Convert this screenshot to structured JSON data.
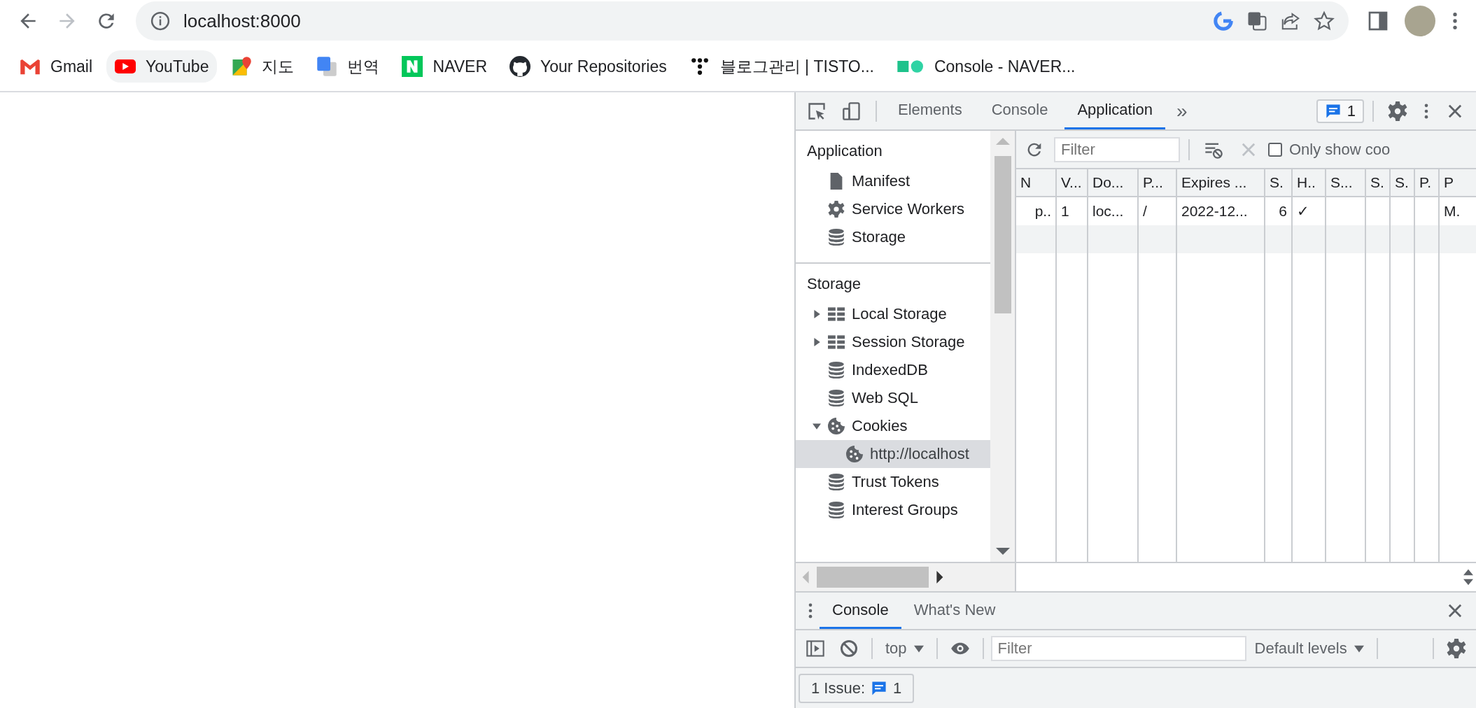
{
  "browser": {
    "url": "localhost:8000",
    "forward_disabled": true
  },
  "bookmarks": [
    {
      "kind": "gmail",
      "label": "Gmail",
      "hovered": false
    },
    {
      "kind": "youtube",
      "label": "YouTube",
      "hovered": true
    },
    {
      "kind": "maps",
      "label": "지도",
      "hovered": false
    },
    {
      "kind": "translate",
      "label": "번역",
      "hovered": false
    },
    {
      "kind": "naver",
      "label": "NAVER",
      "hovered": false
    },
    {
      "kind": "github",
      "label": "Your Repositories",
      "hovered": false
    },
    {
      "kind": "dots",
      "label": "블로그관리 | TISTO...",
      "hovered": false
    },
    {
      "kind": "squares",
      "label": "Console - NAVER...",
      "hovered": false
    }
  ],
  "devtools": {
    "tabs": [
      {
        "label": "Elements",
        "selected": false
      },
      {
        "label": "Console",
        "selected": false
      },
      {
        "label": "Application",
        "selected": true
      }
    ],
    "more_tabs": "»",
    "issues_badge": "1",
    "sidebar": {
      "sections": [
        {
          "title": "Application",
          "items": [
            {
              "kind": "file",
              "label": "Manifest",
              "selected": false
            },
            {
              "kind": "gear",
              "label": "Service Workers",
              "selected": false
            },
            {
              "kind": "database",
              "label": "Storage",
              "selected": false
            }
          ]
        },
        {
          "title": "Storage",
          "items": [
            {
              "kind": "grid",
              "label": "Local Storage",
              "expanded": false,
              "selected": false
            },
            {
              "kind": "grid",
              "label": "Session Storage",
              "expanded": false,
              "selected": false
            },
            {
              "kind": "database",
              "label": "IndexedDB",
              "selected": false
            },
            {
              "kind": "database",
              "label": "Web SQL",
              "selected": false
            },
            {
              "kind": "cookie",
              "label": "Cookies",
              "expanded": true,
              "selected": false,
              "children": [
                {
                  "kind": "cookie",
                  "label": "http://localhost",
                  "selected": true
                }
              ]
            },
            {
              "kind": "database",
              "label": "Trust Tokens",
              "selected": false
            },
            {
              "kind": "database",
              "label": "Interest Groups",
              "selected": false
            }
          ]
        }
      ]
    },
    "cookies": {
      "filter": {
        "placeholder": "Filter"
      },
      "only_show_checkbox": {
        "label": "Only show coo",
        "checked": false
      },
      "table": {
        "columns": [
          "N",
          "V...",
          "Do...",
          "P...",
          "Expires ...",
          "S.",
          "H..",
          "S...",
          "S.",
          "S.",
          "P.",
          "P"
        ],
        "rows": [
          {
            "column_1": "p..",
            "column_2": "1",
            "column_3": "loc...",
            "column_4": "/",
            "column_5": "2022-12...",
            "column_6": "6",
            "column_7": "✓",
            "column_12": "M."
          }
        ]
      }
    },
    "drawer": {
      "tabs": [
        {
          "label": "Console",
          "selected": true
        },
        {
          "label": "What's New",
          "selected": false
        }
      ],
      "context": "top",
      "filter": {
        "placeholder": "Filter"
      },
      "levels": "Default levels",
      "issues": {
        "label": "1 Issue:",
        "count": "1"
      }
    }
  }
}
